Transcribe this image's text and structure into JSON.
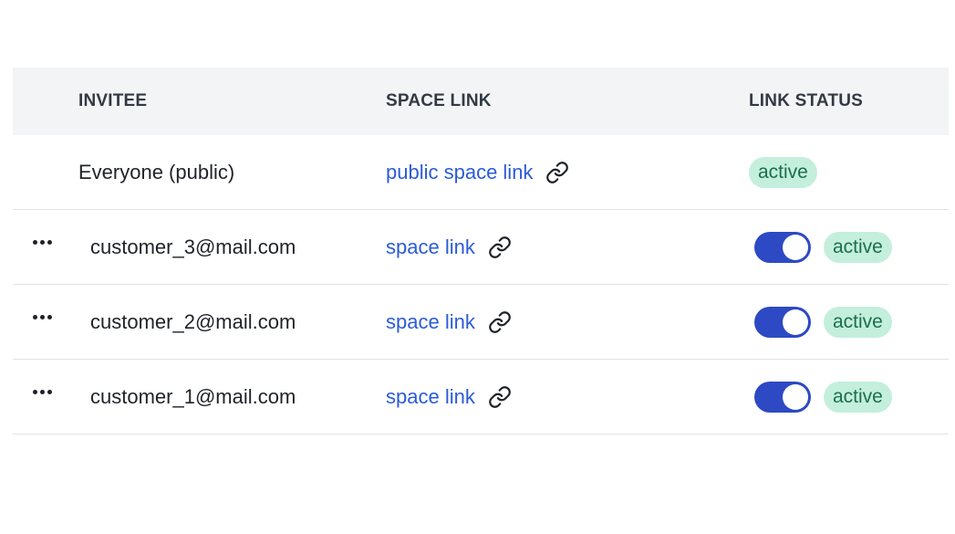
{
  "table": {
    "headers": {
      "invitee": "INVITEE",
      "space_link": "SPACE LINK",
      "link_status": "LINK STATUS"
    },
    "public_row": {
      "invitee": "Everyone (public)",
      "link_label": "public space link",
      "link_icon": "link-icon",
      "status": "active"
    },
    "rows": [
      {
        "invitee": "customer_3@mail.com",
        "link_label": "space link",
        "link_icon": "link-icon",
        "toggle_on": true,
        "status": "active"
      },
      {
        "invitee": "customer_2@mail.com",
        "link_label": "space link",
        "link_icon": "link-icon",
        "toggle_on": true,
        "status": "active"
      },
      {
        "invitee": "customer_1@mail.com",
        "link_label": "space link",
        "link_icon": "link-icon",
        "toggle_on": true,
        "status": "active"
      }
    ]
  },
  "colors": {
    "header_bg": "#f3f4f6",
    "link": "#2b5bd7",
    "toggle_on": "#2d49c4",
    "badge_bg": "#c3efdc",
    "badge_text": "#1c6e4d"
  }
}
